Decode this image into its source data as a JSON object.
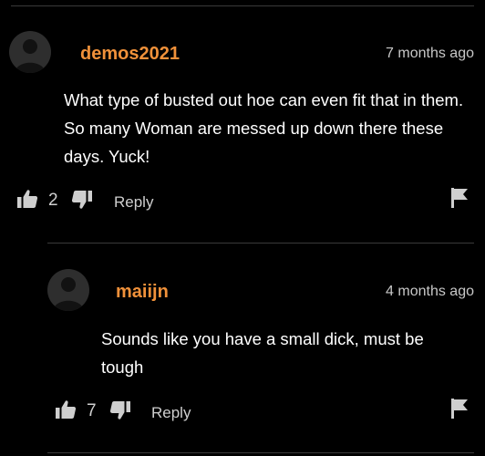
{
  "comments": [
    {
      "username": "demos2021",
      "time": "7 months ago",
      "body": "What type of busted out hoe can even fit that in them. So many Woman are messed up down there these days. Yuck!",
      "likes": "2",
      "reply_label": "Reply"
    },
    {
      "username": "maiijn",
      "time": "4 months ago",
      "body": "Sounds like you have a small dick, must be tough",
      "likes": "7",
      "reply_label": "Reply"
    }
  ],
  "colors": {
    "background": "#000000",
    "username": "#f0913a",
    "text": "#ffffff",
    "muted": "#c8c8c8",
    "divider": "#3a3a3a"
  },
  "icons": [
    "avatar-placeholder-icon",
    "thumbs-up-icon",
    "thumbs-down-icon",
    "flag-icon"
  ]
}
